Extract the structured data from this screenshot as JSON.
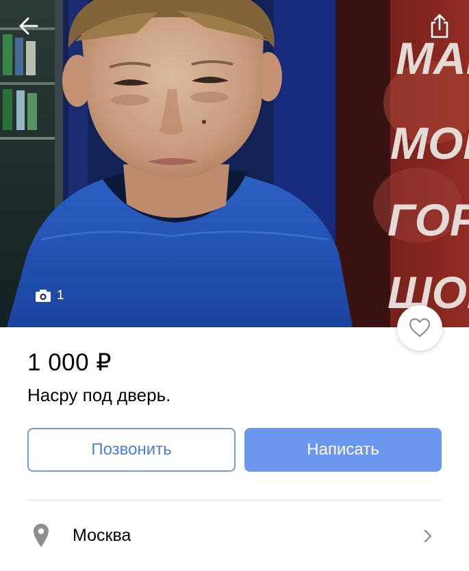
{
  "photo": {
    "counter": "1",
    "sign_lines": [
      "МАГ",
      "МОК",
      "ГОРЯ",
      "ШОК"
    ]
  },
  "listing": {
    "price": "1 000 ₽",
    "title": "Насру под дверь."
  },
  "actions": {
    "call_label": "Позвонить",
    "write_label": "Написать"
  },
  "location": {
    "city": "Москва"
  },
  "icons": {
    "back": "back-arrow-icon",
    "share": "share-icon",
    "camera": "camera-icon",
    "favorite": "heart-icon",
    "location": "location-pin-icon",
    "chevron": "chevron-right-icon"
  },
  "colors": {
    "accent": "#6b97ee",
    "accent_outline": "#6f9be6",
    "accent_text": "#4c7fd9",
    "icon_gray": "#8e8e8e"
  }
}
